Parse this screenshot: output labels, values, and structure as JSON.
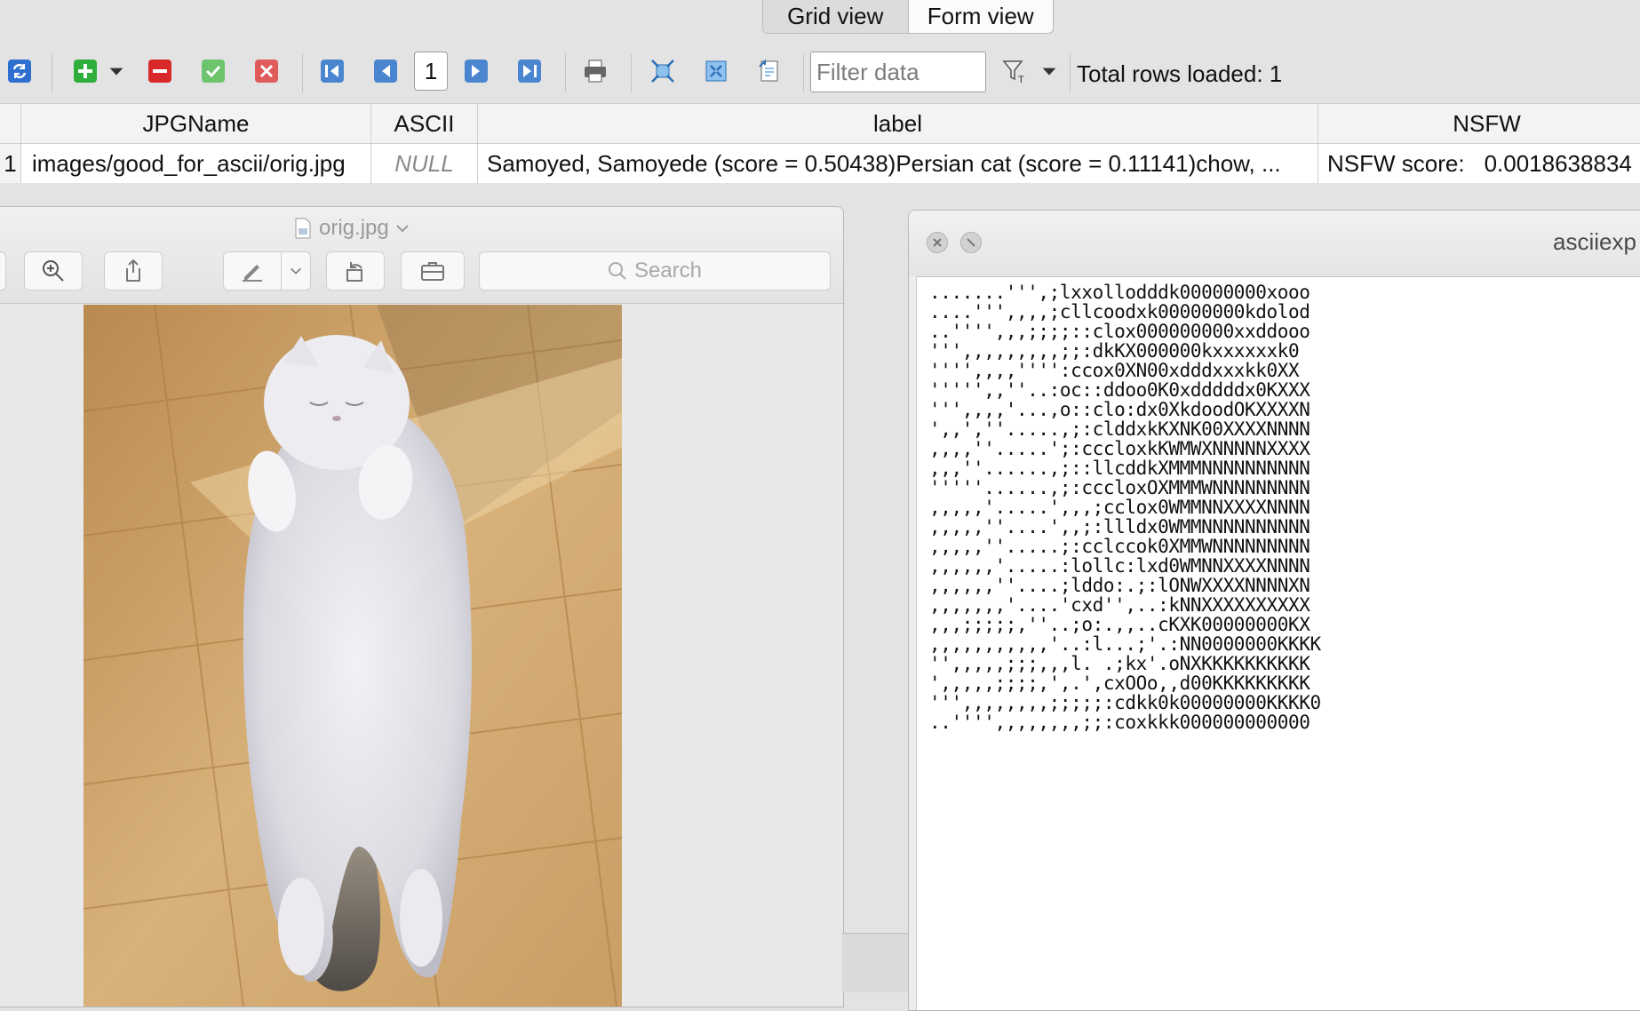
{
  "view_tabs": {
    "grid": "Grid view",
    "form": "Form view"
  },
  "toolbar": {
    "page": "1",
    "filter_placeholder": "Filter data",
    "total_rows": "Total rows loaded: 1",
    "icons": [
      "refresh-icon",
      "add-icon",
      "dropdown-arrow-icon",
      "delete-icon",
      "commit-icon",
      "rollback-icon",
      "first-page-icon",
      "prev-page-icon",
      "next-page-icon",
      "last-page-icon",
      "print-icon",
      "expand-icon",
      "collapse-icon",
      "export-icon",
      "filter-icon"
    ]
  },
  "grid": {
    "columns": [
      "JPGName",
      "ASCII",
      "label",
      "NSFW"
    ],
    "rows": [
      {
        "num": "1",
        "jpgname": "images/good_for_ascii/orig.jpg",
        "ascii": "NULL",
        "label": "Samoyed, Samoyede (score = 0.50438)Persian cat (score = 0.11141)chow, ...",
        "nsfw_label": "NSFW score:",
        "nsfw_value": "0.0018638834"
      }
    ]
  },
  "preview": {
    "title": "orig.jpg",
    "search_placeholder": "Search"
  },
  "ascii_window": {
    "title": "asciiexp",
    "lines": [
      ".......''',;lxxollodddk00000000xooo",
      "....''',,,,;cllcoodxk00000000kdolod",
      "..'''',,,;;;;::clox000000000xxddooo",
      "''',,,,,,,,,;;:dkKX000000kxxxxxxk0",
      "'''',,,,'''':ccox0XN00xdddxxxkk0XX",
      "''''',,''..:oc::ddoo0K0xdddddx0KXXX",
      "''',,,,'...,o::clo:dx0XkdoodOKXXXXN",
      "',,',''.....,;:clddxkKXNK00XXXXNNNN",
      ",,,,''.....';:cccloxkKWMWXNNNNNXXXX",
      ",,,''......,;::llcddkXMMMNNNNNNNNNN",
      "'''''......,;:cccloxOXMMMWNNNNNNNNN",
      ",,,,,'.....',,,;cclox0WMMNNXXXXNNNN",
      ",,,,,''....',,;:llldx0WMMNNNNNNNNNN",
      ",,,,,''.....;:cclccok0XMMWNNNNNNNNN",
      ",,,,,,'.....:lollc:lxd0WMNNXXXXNNNN",
      ",,,,,,''....;lddo:.;:lONWXXXXNNNNXN",
      ",,,,,,,'....'cxd'',..:kNNXXXXXXXXXX",
      ",,,;;;;;,''..;o:.,,..cKXK00000000KX",
      ",,,,,,,,,,,'..:l...;'.:NN0000000KKKK",
      "'',,,,,;;;,,,l. .;kx'.oNXKKKKKKKKKK",
      "',,,,,;;;;,',.',cxOOo,,d00KKKKKKKKK",
      "''',,,,,,,,;;;;;:cdkk0k00000000KKKK0",
      "..'''',,,,,,,,;;:coxkkk000000000000"
    ]
  },
  "colors": {
    "add_green": "#2eae3b",
    "delete_red": "#d8282a",
    "commit_green": "#6cc46c",
    "rollback_red": "#e05b5b",
    "nav_blue": "#4a86cf"
  }
}
